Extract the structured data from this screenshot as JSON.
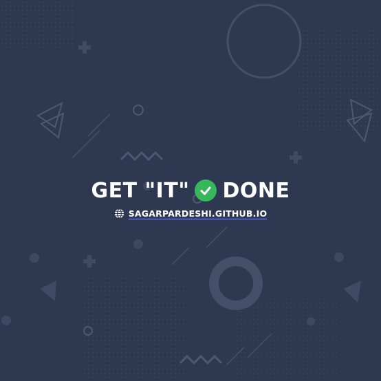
{
  "headline": {
    "before": "GET \"IT\"",
    "after": "DONE",
    "badge_icon": "check-circle-icon",
    "badge_color": "#35b75a"
  },
  "link": {
    "icon": "globe-icon",
    "text": "SAGARPARDESHI.GITHUB.IO"
  },
  "colors": {
    "background": "#2e3850",
    "decor": "#44506a",
    "text": "#ffffff",
    "link_underline": "#7e97ff"
  }
}
